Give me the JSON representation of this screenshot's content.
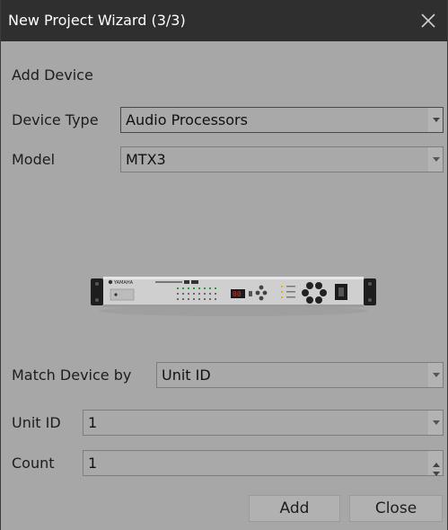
{
  "window": {
    "title": "New Project Wizard (3/3)"
  },
  "section": {
    "heading": "Add Device"
  },
  "device_type": {
    "label": "Device Type",
    "value": "Audio Processors"
  },
  "model": {
    "label": "Model",
    "value": "MTX3"
  },
  "device_image": {
    "brand": "YAMAHA",
    "display_value": "00"
  },
  "match_device": {
    "label": "Match Device by",
    "value": "Unit ID"
  },
  "unit_id": {
    "label": "Unit ID",
    "value": "1"
  },
  "count": {
    "label": "Count",
    "value": "1"
  },
  "buttons": {
    "add": "Add",
    "close": "Close"
  },
  "colors": {
    "titlebar": "#2f2f2f",
    "body": "#a7a7a7",
    "field": "#a9a9a9"
  }
}
